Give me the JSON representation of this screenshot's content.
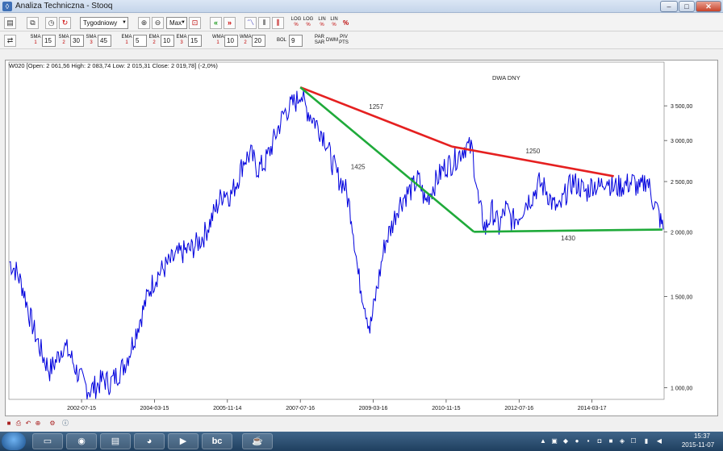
{
  "window": {
    "title": "Analiza Techniczna - Stooq"
  },
  "toolbar1": {
    "interval": "Tygodniowy",
    "range": "Max",
    "scale_buttons": [
      {
        "top": "LOG",
        "bottom": "%"
      },
      {
        "top": "LOG",
        "bottom": "%"
      },
      {
        "top": "LIN",
        "bottom": "%"
      },
      {
        "top": "LIN",
        "bottom": "%"
      }
    ],
    "percent_label": "%"
  },
  "toolbar2": {
    "sma1": {
      "label": "SMA",
      "sub": "1",
      "value": "15"
    },
    "sma2": {
      "label": "SMA",
      "sub": "2",
      "value": "30"
    },
    "sma3": {
      "label": "SMA",
      "sub": "3",
      "value": "45"
    },
    "ema1": {
      "label": "EMA",
      "sub": "1",
      "value": "5"
    },
    "ema2": {
      "label": "EMA",
      "sub": "2",
      "value": "10"
    },
    "ema3": {
      "label": "EMA",
      "sub": "3",
      "value": "15"
    },
    "wma1": {
      "label": "WMA",
      "sub": "1",
      "value": "10"
    },
    "wma2": {
      "label": "WMA",
      "sub": "2",
      "value": "20"
    },
    "bol": {
      "label": "BOL",
      "value": "9"
    },
    "par": {
      "top": "PAR",
      "bottom": "SAR"
    },
    "dwm": "DWM",
    "piv": {
      "top": "PIV",
      "bottom": "PTS"
    }
  },
  "chart_data": {
    "type": "line",
    "info": "W020 [Open: 2 061,56  High: 2 083,74  Low: 2 015,31  Close: 2 019,78] (-2,0%)",
    "annotation": "DWA DNY",
    "x_ticks": [
      "2002-07-15",
      "2004-03-15",
      "2005-11-14",
      "2007-07-16",
      "2009-03-16",
      "2010-11-15",
      "2012-07-16",
      "2014-03-17"
    ],
    "y_ticks": [
      "1 000,00",
      "1 500,00",
      "2 000,00",
      "2 500,00",
      "3 000,00",
      "3 500,00"
    ],
    "y_scale": "log",
    "ylim": [
      950,
      4100
    ],
    "series": [
      {
        "color": "#0000dd",
        "x": [
          "2000-11-20",
          "2001-01-15",
          "2001-03-12",
          "2001-05-07",
          "2001-07-02",
          "2001-08-27",
          "2001-10-22",
          "2001-12-17",
          "2002-02-11",
          "2002-04-08",
          "2002-06-03",
          "2002-07-29",
          "2002-09-23",
          "2002-11-18",
          "2003-01-13",
          "2003-03-10",
          "2003-05-05",
          "2003-06-30",
          "2003-08-25",
          "2003-10-20",
          "2003-12-15",
          "2004-02-09",
          "2004-04-05",
          "2004-05-31",
          "2004-07-26",
          "2004-09-20",
          "2004-11-15",
          "2005-01-10",
          "2005-03-07",
          "2005-05-02",
          "2005-06-27",
          "2005-08-22",
          "2005-10-17",
          "2005-12-12",
          "2006-02-06",
          "2006-04-03",
          "2006-05-29",
          "2006-07-24",
          "2006-09-18",
          "2006-11-13",
          "2007-01-08",
          "2007-03-05",
          "2007-04-30",
          "2007-06-25",
          "2007-07-16",
          "2007-08-20",
          "2007-10-15",
          "2007-12-10",
          "2008-02-04",
          "2008-03-31",
          "2008-05-26",
          "2008-07-21",
          "2008-09-15",
          "2008-11-10",
          "2009-01-05",
          "2009-02-16",
          "2009-03-02",
          "2009-04-27",
          "2009-06-22",
          "2009-08-17",
          "2009-10-12",
          "2009-12-07",
          "2010-02-01",
          "2010-03-29",
          "2010-05-24",
          "2010-07-19",
          "2010-09-13",
          "2010-11-08",
          "2011-01-03",
          "2011-02-28",
          "2011-04-25",
          "2011-06-20",
          "2011-08-15",
          "2011-10-10",
          "2011-12-05",
          "2012-01-30",
          "2012-03-26",
          "2012-05-21",
          "2012-07-16",
          "2012-09-10",
          "2012-11-05",
          "2012-12-31",
          "2013-02-25",
          "2013-04-22",
          "2013-06-17",
          "2013-08-12",
          "2013-10-07",
          "2013-12-02",
          "2014-01-27",
          "2014-03-24",
          "2014-05-19",
          "2014-07-14",
          "2014-09-08",
          "2014-11-03",
          "2014-12-29",
          "2015-02-23",
          "2015-04-20",
          "2015-06-15",
          "2015-08-10",
          "2015-09-21",
          "2015-10-12",
          "2015-11-02"
        ],
        "y": [
          1750,
          1680,
          1560,
          1380,
          1250,
          1150,
          1080,
          1130,
          1210,
          1160,
          1080,
          1020,
          990,
          1010,
          1040,
          1020,
          1060,
          1100,
          1180,
          1300,
          1420,
          1560,
          1650,
          1700,
          1750,
          1800,
          1830,
          1850,
          1900,
          1970,
          2100,
          2250,
          2400,
          2350,
          2520,
          2760,
          2820,
          2650,
          2700,
          2900,
          3150,
          3400,
          3500,
          3600,
          3750,
          3500,
          3350,
          3200,
          3050,
          2750,
          2550,
          2450,
          2150,
          1650,
          1450,
          1300,
          1350,
          1600,
          1900,
          2050,
          2250,
          2350,
          2420,
          2530,
          2280,
          2420,
          2560,
          2680,
          2720,
          2820,
          2930,
          2880,
          2250,
          2020,
          2200,
          2040,
          2220,
          2100,
          2150,
          2280,
          2350,
          2480,
          2420,
          2260,
          2200,
          2380,
          2500,
          2450,
          2380,
          2480,
          2430,
          2550,
          2430,
          2450,
          2470,
          2500,
          2400,
          2540,
          2300,
          2180,
          2090,
          2020
        ]
      }
    ],
    "trendlines": [
      {
        "color": "#e52020",
        "label": "1257",
        "points": [
          [
            "2007-07-16",
            3800
          ],
          [
            "2011-01-03",
            2920
          ]
        ]
      },
      {
        "color": "#e52020",
        "label": "1250",
        "points": [
          [
            "2011-01-03",
            2920
          ],
          [
            "2014-09-15",
            2560
          ]
        ]
      },
      {
        "color": "#1faa3a",
        "label": "1425",
        "points": [
          [
            "2007-07-16",
            3800
          ],
          [
            "2011-07-04",
            2000
          ]
        ]
      },
      {
        "color": "#1faa3a",
        "label": "1430",
        "points": [
          [
            "2011-07-04",
            2000
          ],
          [
            "2015-10-26",
            2020
          ]
        ]
      }
    ]
  },
  "statusbar": {
    "icons": [
      "save-icon",
      "print-icon",
      "undo-icon",
      "zoom-icon",
      "settings-icon",
      "info-icon"
    ]
  },
  "taskbar": {
    "apps": [
      "desktop",
      "firefox",
      "explorer",
      "chrome",
      "media",
      "stooq",
      "java"
    ],
    "time": "15:37",
    "date": "2015-11-07"
  }
}
